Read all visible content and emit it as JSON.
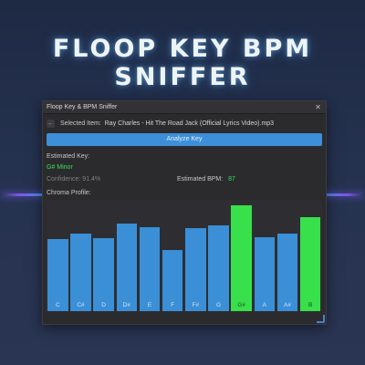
{
  "banner": {
    "title": "FLOOP KEY BPM SNIFFER"
  },
  "window": {
    "title": "Floop Key & BPM Sniffer",
    "close_icon": "close-icon",
    "selected_item_label": "Selected Item:",
    "selected_item_value": "Ray Charles - Hit The Road Jack (Official Lyrics Video).mp3",
    "back_icon": "back-arrow-icon",
    "analyze_label": "Analyze Key",
    "estimated_key_label": "Estimated Key:",
    "estimated_key_value": "G# Minor",
    "confidence_text": "Confidence: 91.4%",
    "estimated_bpm_label": "Estimated BPM:",
    "estimated_bpm_value": "87",
    "chroma_label": "Chroma Profile:"
  },
  "colors": {
    "accent_blue": "#3a8fd6",
    "highlight_green": "#38e04c",
    "key_text_green": "#37e05a"
  },
  "chart_data": {
    "type": "bar",
    "categories": [
      "C",
      "C#",
      "D",
      "D#",
      "E",
      "F",
      "F#",
      "G",
      "G#",
      "A",
      "A#",
      "B"
    ],
    "values": [
      0.68,
      0.73,
      0.69,
      0.83,
      0.79,
      0.58,
      0.78,
      0.81,
      1.0,
      0.7,
      0.73,
      0.89
    ],
    "highlighted": [
      "G#",
      "B"
    ],
    "ylim": [
      0,
      1.05
    ]
  }
}
